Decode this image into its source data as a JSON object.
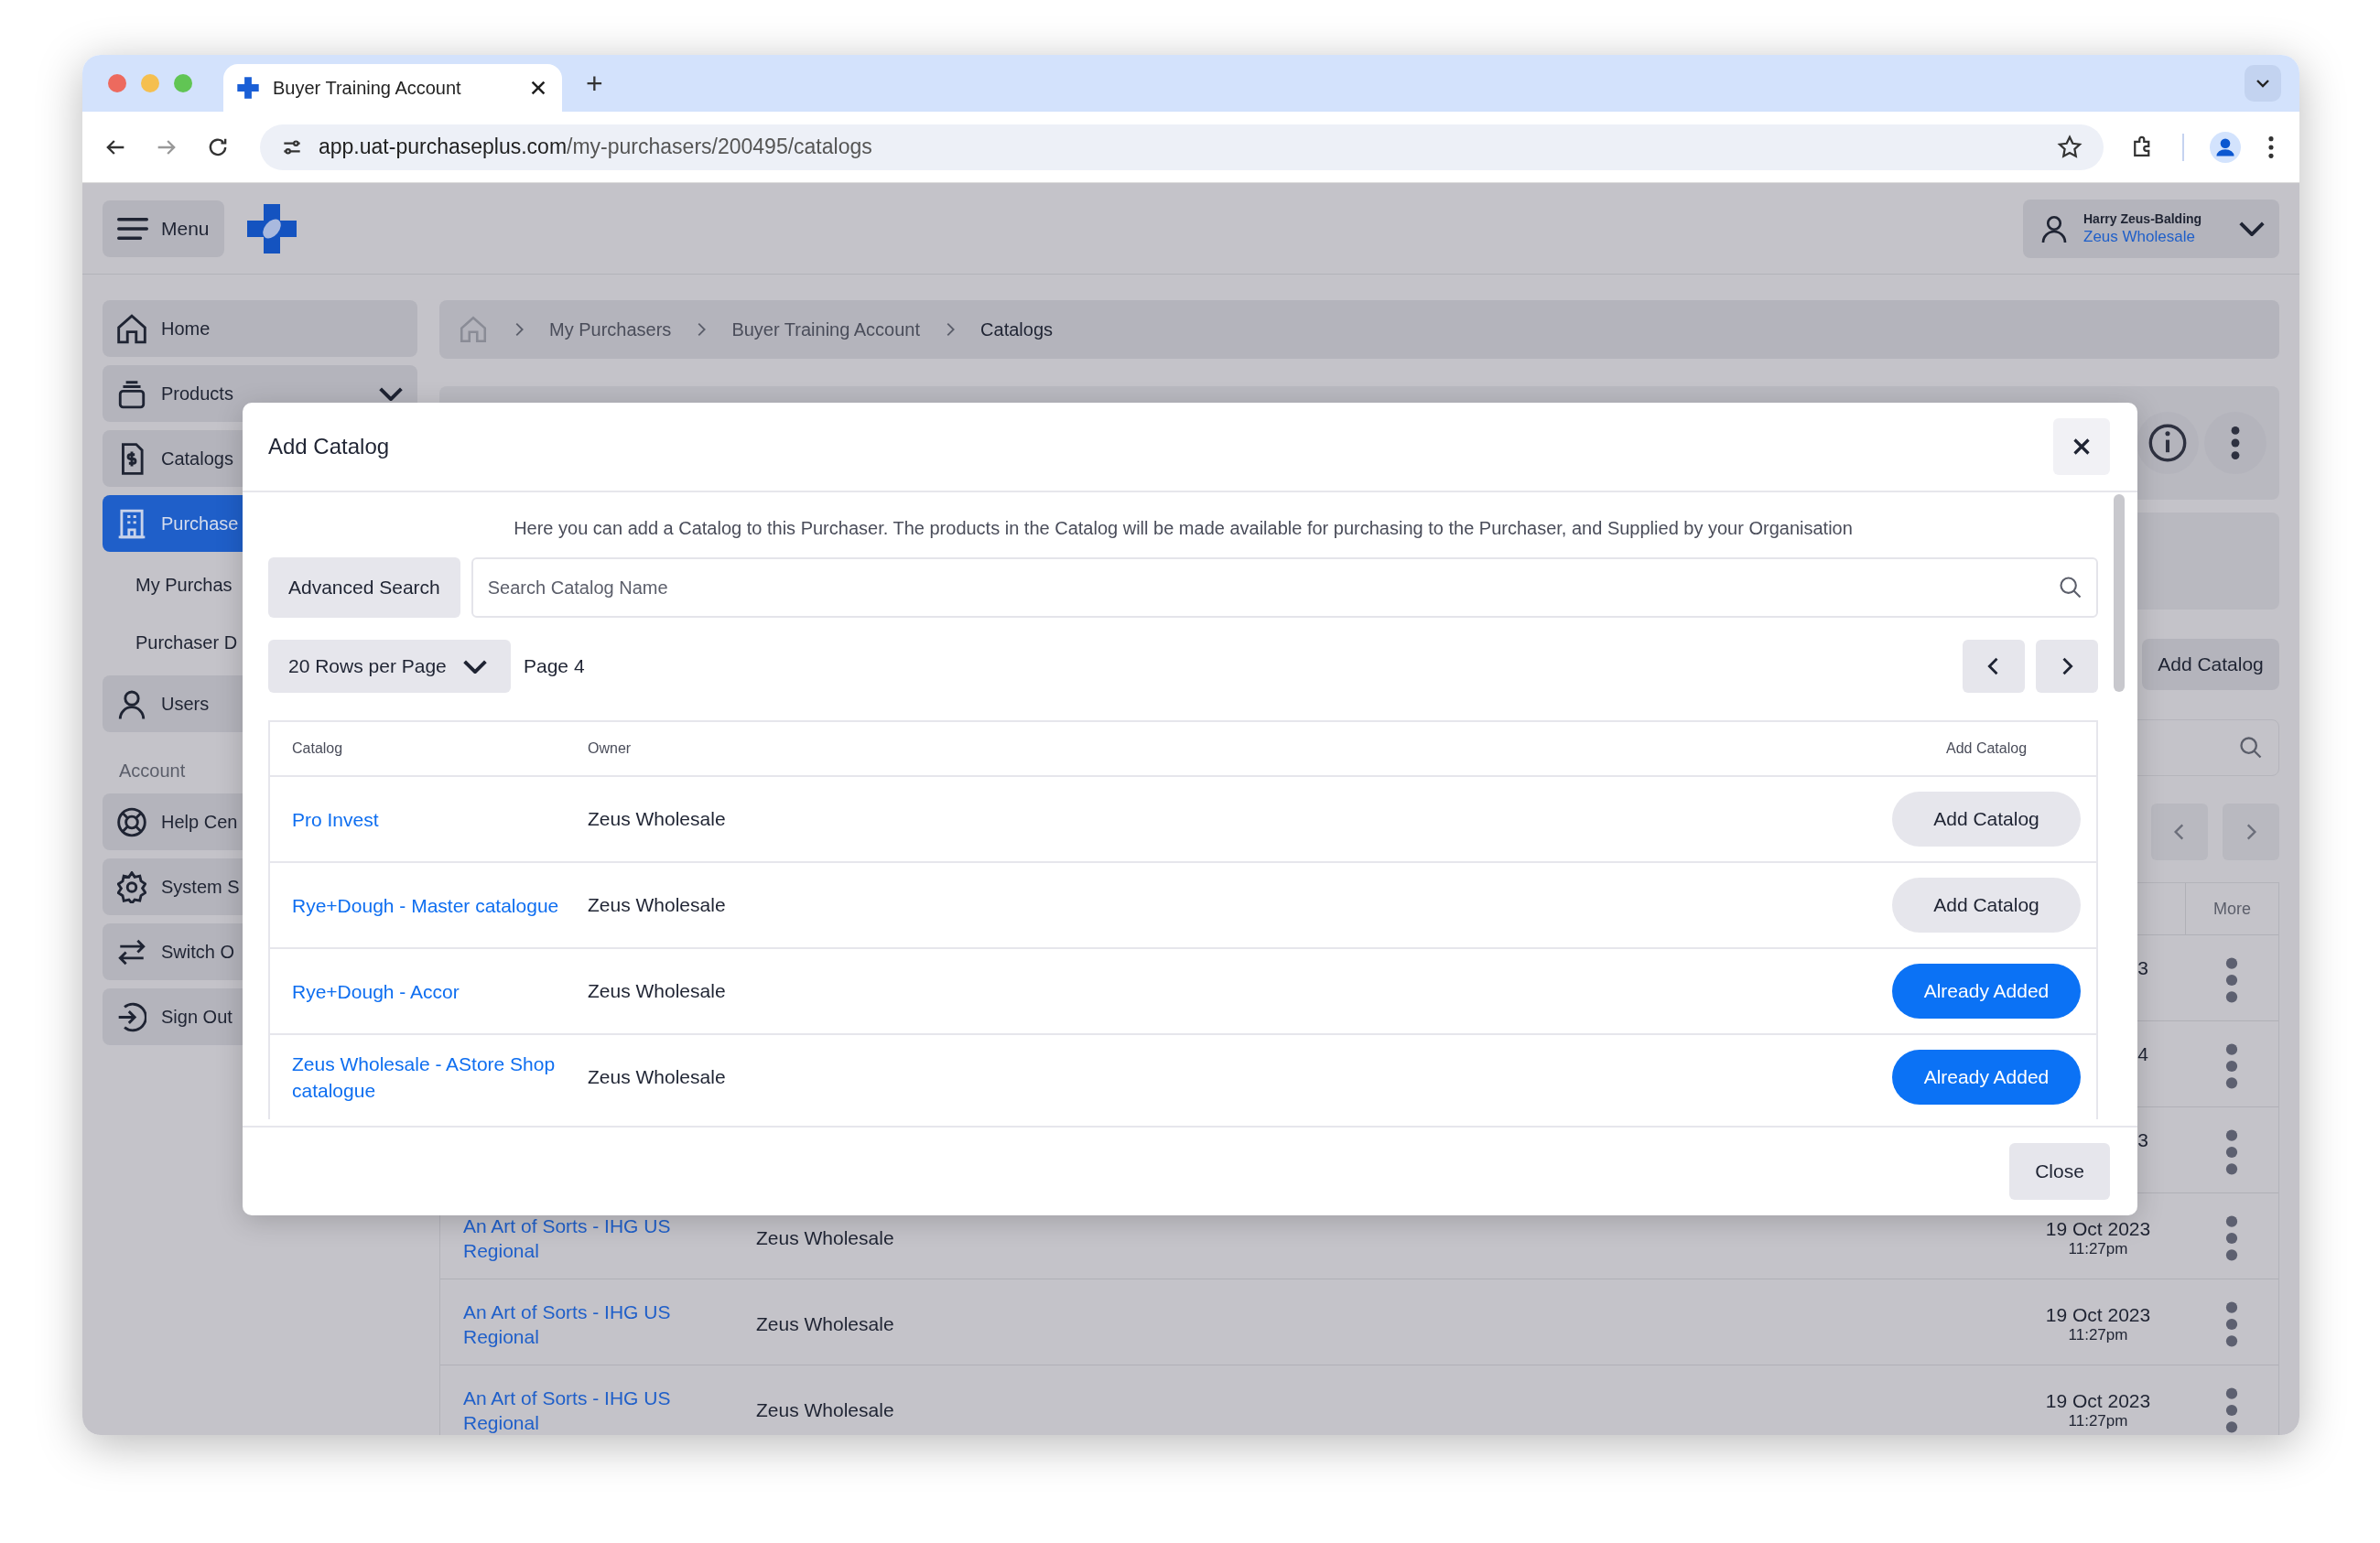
{
  "browser": {
    "tab_title": "Buyer Training Account",
    "new_tab": "+",
    "url_host": "app.uat-purchaseplus.com",
    "url_path": "/my-purchasers/200495/catalogs"
  },
  "header": {
    "menu_label": "Menu",
    "user_name": "Harry Zeus-Balding",
    "user_org": "Zeus Wholesale"
  },
  "sidebar": [
    {
      "kind": "link",
      "label": "Home",
      "selected": false
    },
    {
      "kind": "group",
      "label": "Products",
      "selected": false
    },
    {
      "kind": "link",
      "label": "Catalogs",
      "selected": false
    },
    {
      "kind": "link",
      "label": "Purchase",
      "selected": true
    },
    {
      "kind": "sub",
      "label": "My Purchas",
      "selected": false
    },
    {
      "kind": "sub",
      "label": "Purchaser D",
      "selected": false
    },
    {
      "kind": "link",
      "label": "Users",
      "selected": false
    },
    {
      "kind": "heading",
      "label": "Account"
    },
    {
      "kind": "link",
      "label": "Help Cen",
      "selected": false
    },
    {
      "kind": "link",
      "label": "System S",
      "selected": false
    },
    {
      "kind": "link",
      "label": "Switch O",
      "selected": false
    },
    {
      "kind": "link",
      "label": "Sign Out",
      "selected": false
    }
  ],
  "breadcrumb": [
    "My Purchasers",
    "Buyer Training Account",
    "Catalogs"
  ],
  "page": {
    "add_catalog_label": "Add Catalog",
    "more_heading": "More",
    "rows": [
      {
        "date": "3"
      },
      {
        "date": "4"
      },
      {
        "date": "3"
      },
      {
        "catalog": "An Art of Sorts - IHG US Regional",
        "owner": "Zeus Wholesale",
        "date": "19 Oct 2023",
        "time": "11:27pm"
      },
      {
        "catalog": "An Art of Sorts - IHG US Regional",
        "owner": "Zeus Wholesale",
        "date": "19 Oct 2023",
        "time": "11:27pm"
      },
      {
        "catalog": "An Art of Sorts - IHG US Regional",
        "owner": "Zeus Wholesale",
        "date": "19 Oct 2023",
        "time": "11:27pm"
      }
    ]
  },
  "modal": {
    "title": "Add Catalog",
    "description": "Here you can add a Catalog to this Purchaser. The products in the Catalog will be made available for purchasing to the Purchaser, and Supplied by your Organisation",
    "advanced_search": "Advanced Search",
    "search_placeholder": "Search Catalog Name",
    "rows_per_page": "20 Rows per Page",
    "page_label": "Page 4",
    "columns": [
      "Catalog",
      "Owner",
      "Add Catalog"
    ],
    "rows": [
      {
        "catalog": "Pro Invest",
        "owner": "Zeus Wholesale",
        "action": "Add Catalog",
        "added": false
      },
      {
        "catalog": "Rye+Dough - Master catalogue",
        "owner": "Zeus Wholesale",
        "action": "Add Catalog",
        "added": false
      },
      {
        "catalog": "Rye+Dough - Accor",
        "owner": "Zeus Wholesale",
        "action": "Already Added",
        "added": true
      },
      {
        "catalog": "Zeus Wholesale - AStore Shop catalogue",
        "owner": "Zeus Wholesale",
        "action": "Already Added",
        "added": true
      }
    ],
    "close_label": "Close"
  }
}
